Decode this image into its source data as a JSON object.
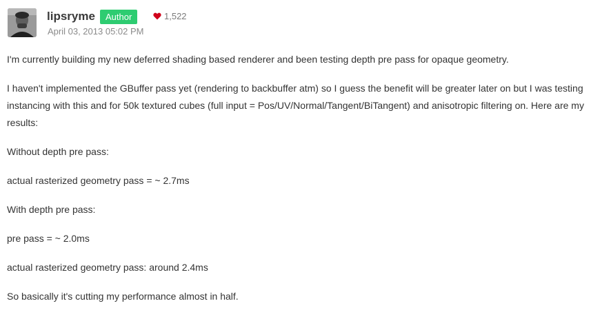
{
  "post": {
    "author": "lipsryme",
    "badge": "Author",
    "reputation": "1,522",
    "date": "April 03, 2013 05:02 PM",
    "paragraphs": [
      "I'm currently building my new deferred shading based renderer and been testing depth pre pass for opaque geometry.",
      "I haven't implemented the GBuffer pass yet (rendering to backbuffer atm) so I guess the benefit will be greater later on but I was testing instancing with this and for 50k textured cubes (full input = Pos/UV/Normal/Tangent/BiTangent) and anisotropic filtering on. Here are my results:",
      "Without depth pre pass:",
      "actual rasterized geometry pass = ~ 2.7ms",
      "With depth pre pass:",
      "pre pass = ~ 2.0ms",
      "actual rasterized geometry pass: around 2.4ms",
      "So basically it's cutting my performance almost in half."
    ]
  },
  "icons": {
    "avatar": "avatar-photo",
    "reputation": "heart-icon"
  },
  "colors": {
    "badge": "#2ecc71",
    "heart": "#d0021b"
  }
}
